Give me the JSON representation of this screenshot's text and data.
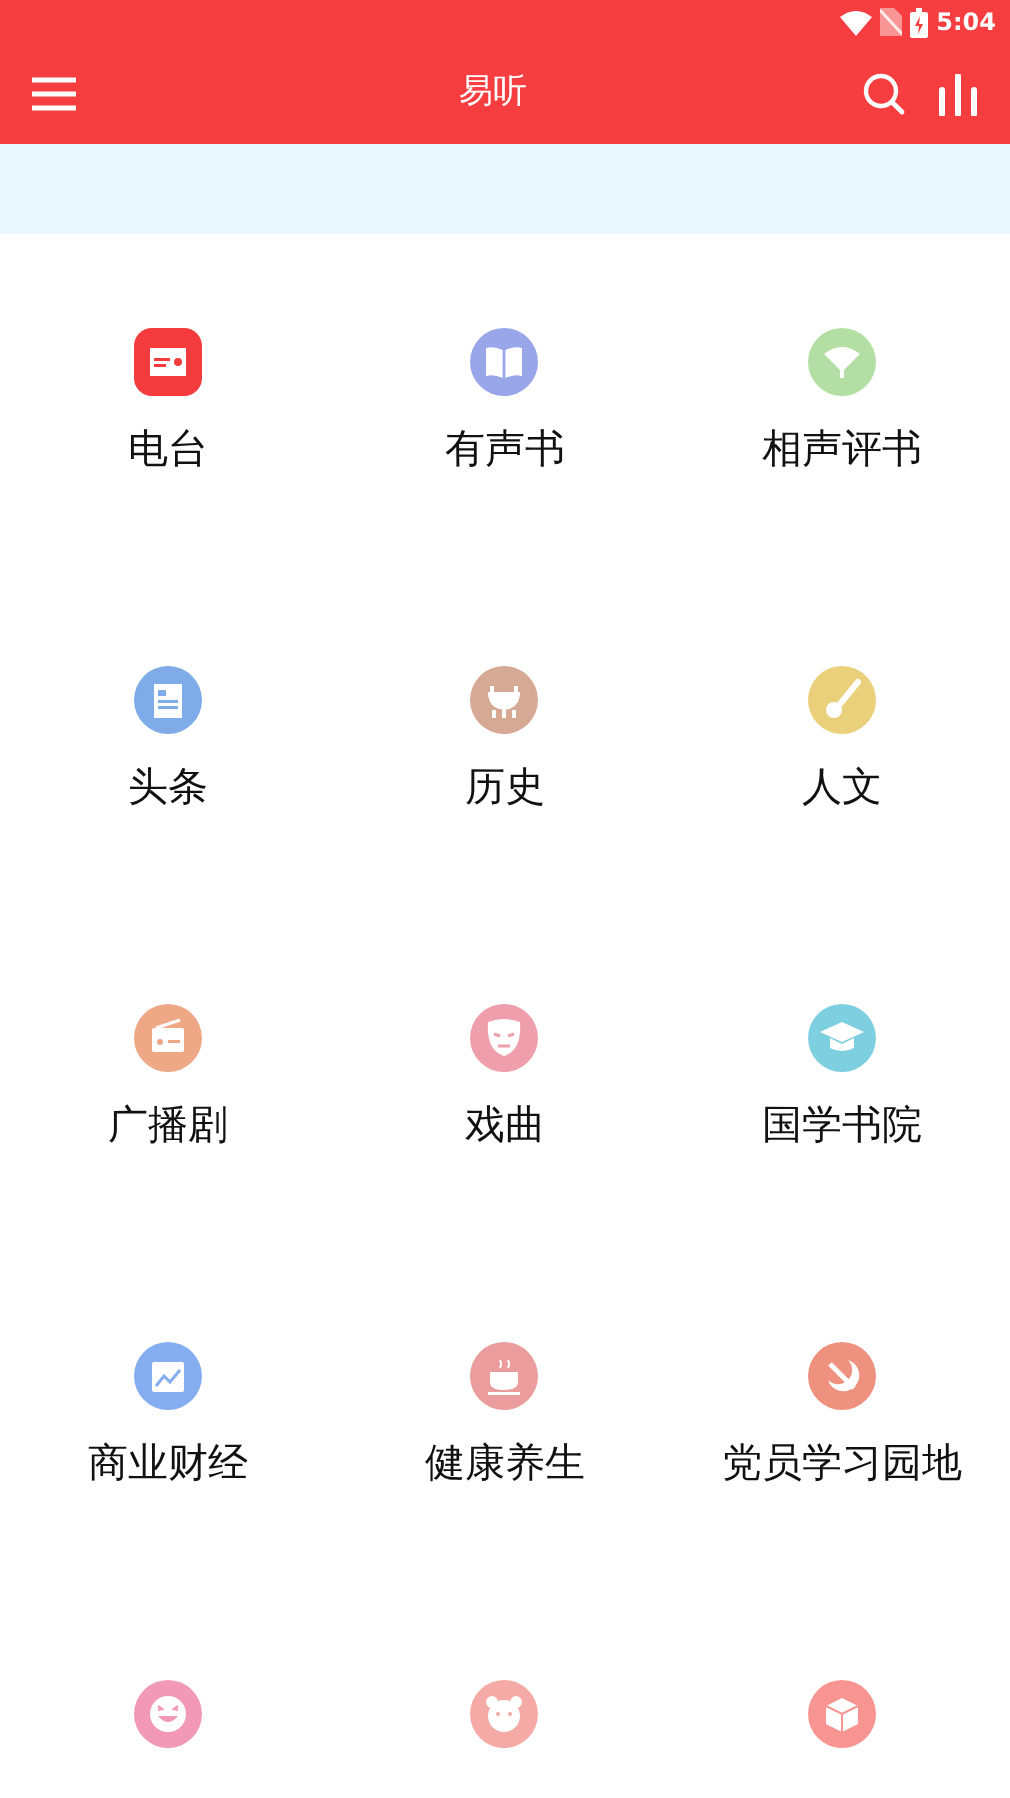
{
  "status_bar": {
    "time": "5:04"
  },
  "app_bar": {
    "title": "易听"
  },
  "categories": [
    {
      "label": "电台",
      "color": "#f43c3e"
    },
    {
      "label": "有声书",
      "color": "#9aa6ea"
    },
    {
      "label": "相声评书",
      "color": "#b3dfa5"
    },
    {
      "label": "头条",
      "color": "#7fabe8"
    },
    {
      "label": "历史",
      "color": "#d6a994"
    },
    {
      "label": "人文",
      "color": "#ebd07c"
    },
    {
      "label": "广播剧",
      "color": "#eea886"
    },
    {
      "label": "戏曲",
      "color": "#ef9eab"
    },
    {
      "label": "国学书院",
      "color": "#7ecfe0"
    },
    {
      "label": "商业财经",
      "color": "#84aeef"
    },
    {
      "label": "健康养生",
      "color": "#eb9c9d"
    },
    {
      "label": "党员学习园地",
      "color": "#ee917f"
    },
    {
      "color": "#f299b7"
    },
    {
      "color": "#f5aaa5"
    },
    {
      "color": "#f89491"
    }
  ]
}
